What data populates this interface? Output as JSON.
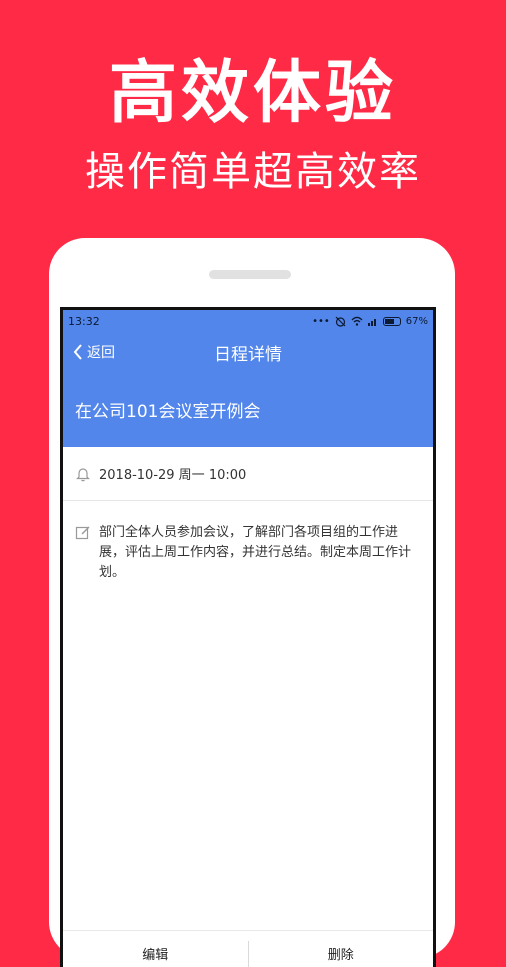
{
  "promo": {
    "title": "高效体验",
    "subtitle": "操作简单超高效率"
  },
  "statusbar": {
    "time": "13:32",
    "battery": "67%"
  },
  "nav": {
    "back_label": "返回",
    "title": "日程详情"
  },
  "event": {
    "title": "在公司101会议室开例会",
    "datetime": "2018-10-29 周一 10:00",
    "description": "部门全体人员参加会议，了解部门各项目组的工作进展，评估上周工作内容，并进行总结。制定本周工作计划。"
  },
  "actions": {
    "edit_label": "编辑",
    "delete_label": "删除"
  },
  "colors": {
    "background": "#ff2a45",
    "header": "#5286ea"
  }
}
